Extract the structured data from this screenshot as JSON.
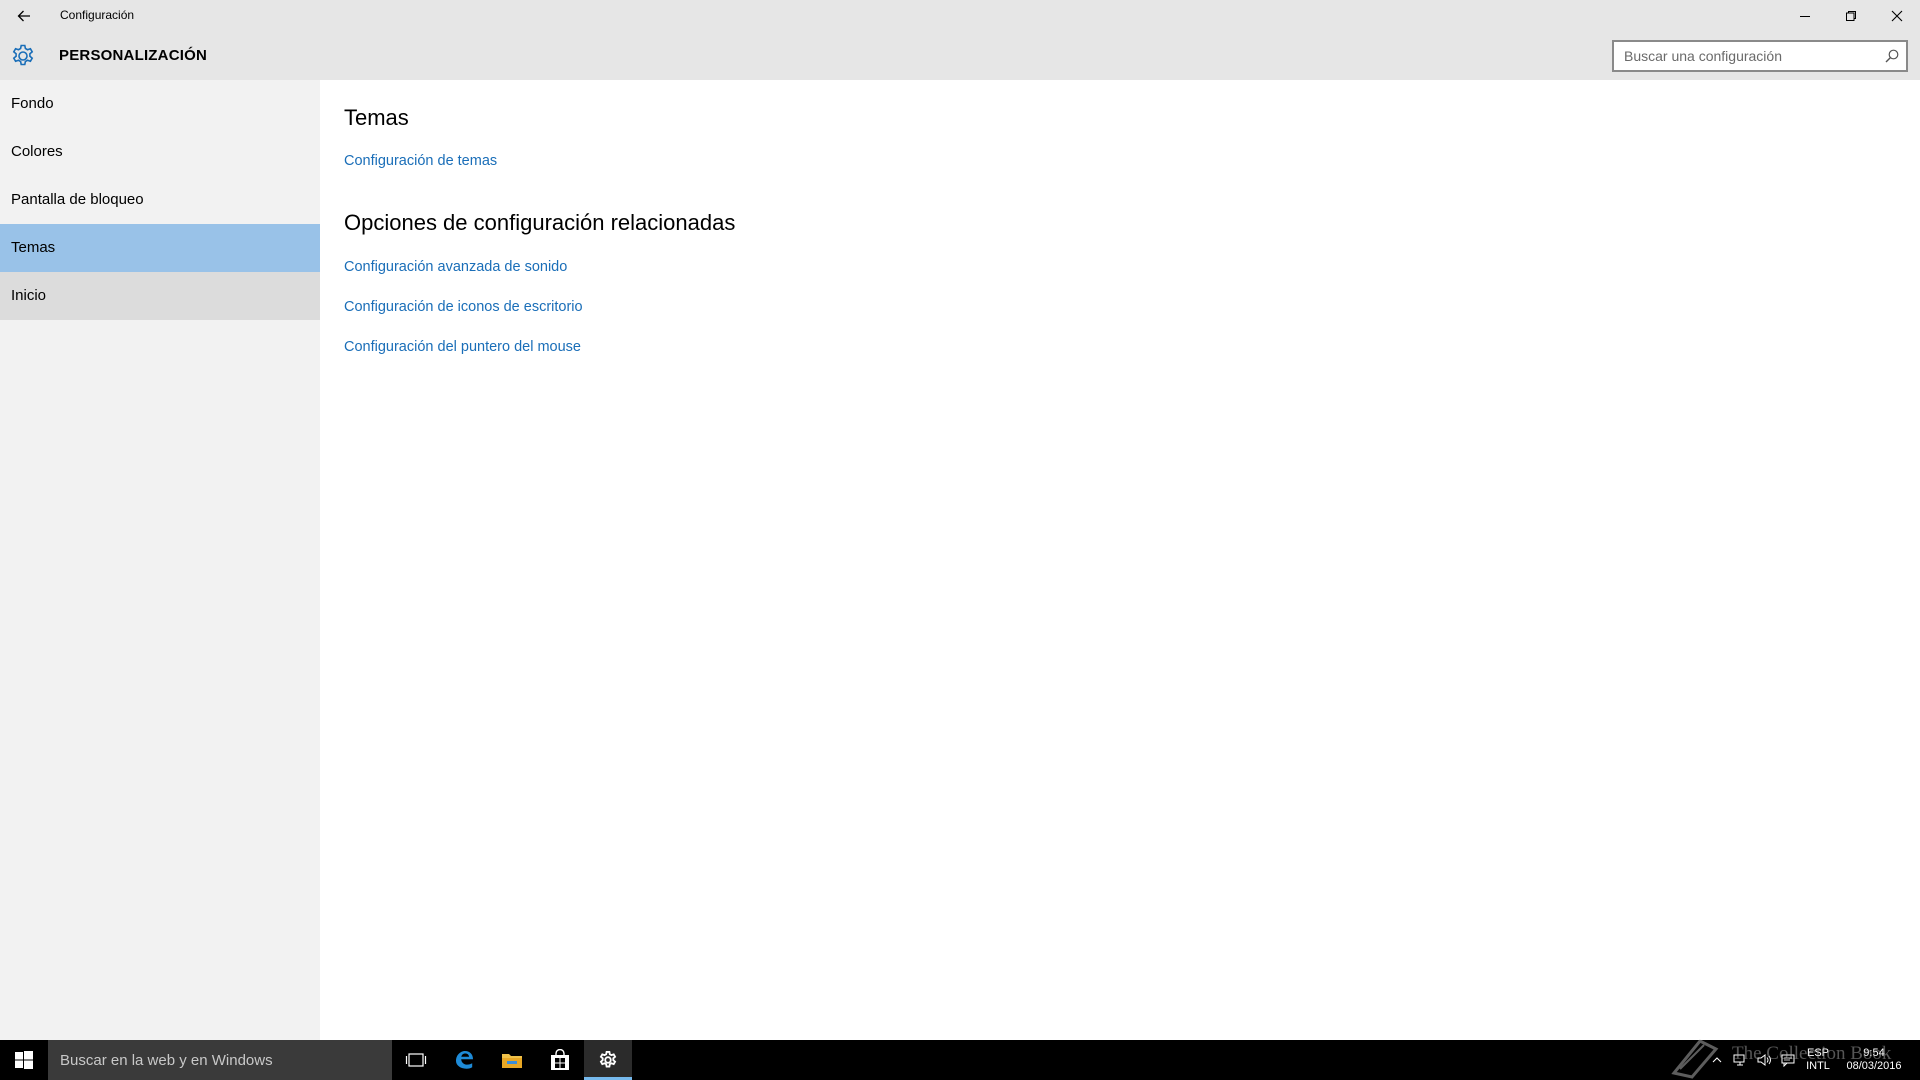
{
  "window": {
    "title": "Configuración",
    "back_icon": "back-arrow-icon",
    "controls": [
      "minimize-icon",
      "restore-icon",
      "close-icon"
    ]
  },
  "header": {
    "icon": "gear-icon",
    "title": "PERSONALIZACIÓN",
    "search_placeholder": "Buscar una configuración"
  },
  "sidebar": {
    "items": [
      {
        "label": "Fondo",
        "state": "normal"
      },
      {
        "label": "Colores",
        "state": "normal"
      },
      {
        "label": "Pantalla de bloqueo",
        "state": "normal"
      },
      {
        "label": "Temas",
        "state": "selected"
      },
      {
        "label": "Inicio",
        "state": "hover"
      }
    ]
  },
  "main": {
    "section_title": "Temas",
    "section_link": "Configuración de temas",
    "related_title": "Opciones de configuración relacionadas",
    "related_links": [
      "Configuración avanzada de sonido",
      "Configuración de iconos de escritorio",
      "Configuración del puntero del mouse"
    ]
  },
  "taskbar": {
    "search_placeholder": "Buscar en la web y en Windows",
    "apps": [
      "task-view-icon",
      "edge-icon",
      "file-explorer-icon",
      "store-icon",
      "settings-icon"
    ],
    "active_app": "settings-icon",
    "language_top": "ESP",
    "language_bottom": "INTL",
    "time": "9:54",
    "date": "08/03/2016"
  },
  "watermark": {
    "text": "The Collection Book"
  },
  "colors": {
    "accent": "#1a6eb8",
    "selected_bg": "#99c2e8",
    "sidebar_bg": "#f2f2f2",
    "titlebar_bg": "#e6e6e6",
    "taskbar_bg": "#000000"
  }
}
